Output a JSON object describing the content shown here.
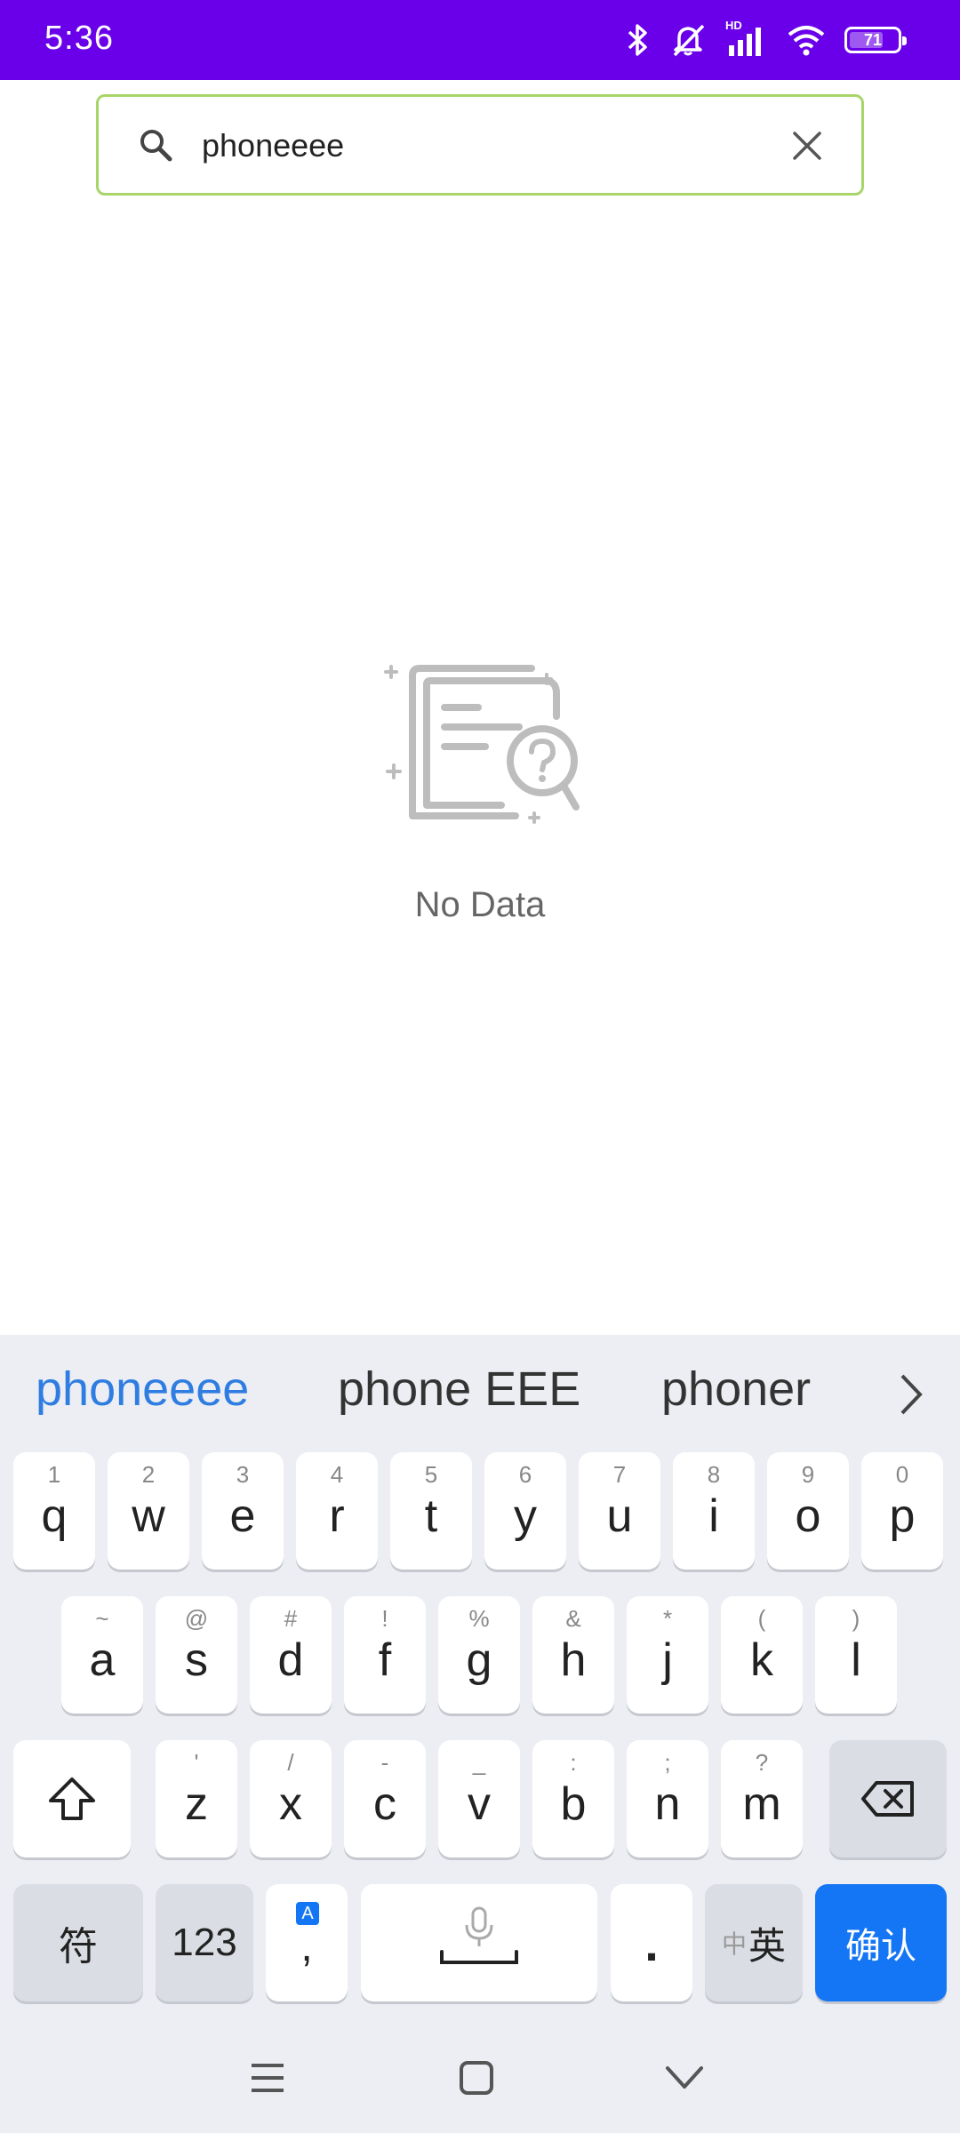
{
  "status_bar": {
    "time": "5:36",
    "hd_label": "HD",
    "battery_level": 71,
    "battery_text": "71",
    "icons": [
      "bluetooth-icon",
      "mute-icon",
      "signal-icon",
      "wifi-icon",
      "battery-icon"
    ]
  },
  "search": {
    "value": "phoneeee",
    "icon": "search-icon",
    "clear_icon": "close-icon",
    "border_color": "#a8d56a"
  },
  "empty_state": {
    "icon": "no-data-icon",
    "text": "No Data"
  },
  "keyboard": {
    "suggestions": [
      "phoneeee",
      "phone EEE",
      "phoner"
    ],
    "row1": [
      {
        "main": "q",
        "sub": "1"
      },
      {
        "main": "w",
        "sub": "2"
      },
      {
        "main": "e",
        "sub": "3"
      },
      {
        "main": "r",
        "sub": "4"
      },
      {
        "main": "t",
        "sub": "5"
      },
      {
        "main": "y",
        "sub": "6"
      },
      {
        "main": "u",
        "sub": "7"
      },
      {
        "main": "i",
        "sub": "8"
      },
      {
        "main": "o",
        "sub": "9"
      },
      {
        "main": "p",
        "sub": "0"
      }
    ],
    "row2": [
      {
        "main": "a",
        "sub": "~"
      },
      {
        "main": "s",
        "sub": "@"
      },
      {
        "main": "d",
        "sub": "#"
      },
      {
        "main": "f",
        "sub": "!"
      },
      {
        "main": "g",
        "sub": "%"
      },
      {
        "main": "h",
        "sub": "&"
      },
      {
        "main": "j",
        "sub": "*"
      },
      {
        "main": "k",
        "sub": "("
      },
      {
        "main": "l",
        "sub": ")"
      }
    ],
    "row3": [
      {
        "main": "z",
        "sub": "'"
      },
      {
        "main": "x",
        "sub": "/"
      },
      {
        "main": "c",
        "sub": "-"
      },
      {
        "main": "v",
        "sub": "_"
      },
      {
        "main": "b",
        "sub": ":"
      },
      {
        "main": "n",
        "sub": ";"
      },
      {
        "main": "m",
        "sub": "?"
      }
    ],
    "symbol_key": "符",
    "numbers_key": "123",
    "comma_key": ",",
    "comma_badge": "A",
    "period_key": ".",
    "lang_small": "中",
    "lang_main": "英",
    "confirm_key": "确认",
    "accent_color": "#1476f5"
  },
  "nav": {
    "icons": [
      "menu-icon",
      "home-icon",
      "back-icon"
    ]
  }
}
